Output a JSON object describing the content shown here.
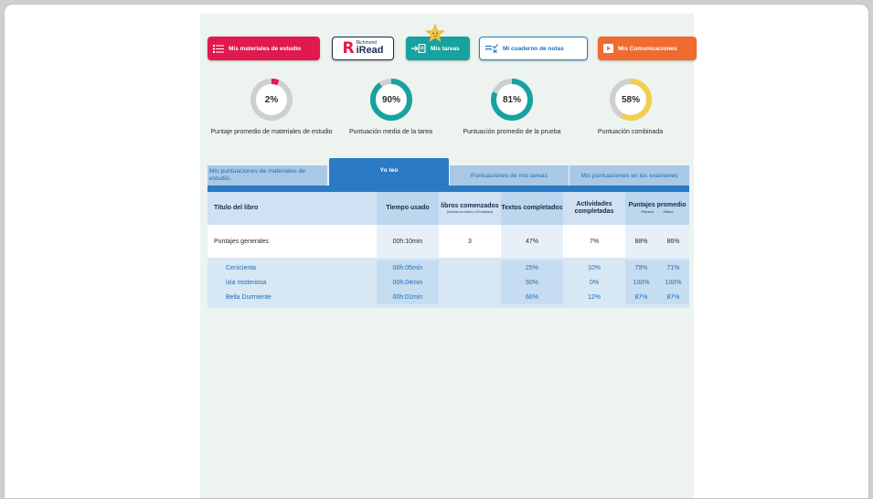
{
  "nav": {
    "materials_label": "Mis materiales de estudio",
    "iread_brand_small": "Richmond",
    "iread_brand_big": "iRead",
    "tareas_label": "Mis tareas",
    "cuaderno_label": "Mi cuaderno de notas",
    "comunicaciones_label": "Mis Comunicaciones"
  },
  "scores": [
    {
      "value": "2%",
      "percent": 2,
      "color": "#e0194f",
      "label": "Puntaje promedio de materiales de estudio"
    },
    {
      "value": "90%",
      "percent": 90,
      "color": "#16a2a0",
      "label": "Puntuación media de la tarea"
    },
    {
      "value": "81%",
      "percent": 81,
      "color": "#16a2a0",
      "label": "Puntuación promedio de la prueba"
    },
    {
      "value": "58%",
      "percent": 58,
      "color": "#f2cf4a",
      "label": "Puntuación combinada"
    }
  ],
  "tabs": {
    "materiales": "Mis puntuaciones de materiales de estudio.",
    "yoleo": "Yo leo",
    "tareas": "Puntuaciones de mis tareas",
    "examenes": "Mis puntuaciones en los exámenes"
  },
  "table": {
    "headers": {
      "titulo": "Título del libro",
      "tiempo": "Tiempo usado",
      "libros": "libros comenzados",
      "libros_note": "(mínimo un envío o 10 minutos)",
      "textos": "Textos completados",
      "actividades": "Actividades completadas",
      "puntajes": "Puntajes promedio",
      "primero": "Primero",
      "ultimo": "Último"
    },
    "general": {
      "label": "Puntajes generales",
      "tiempo": "00h:10min",
      "libros": "3",
      "textos": "47%",
      "actividades": "7%",
      "primero": "88%",
      "ultimo": "86%"
    },
    "books": [
      {
        "title": "Cenicienta",
        "tiempo": "00h:05min",
        "textos": "25%",
        "actividades": "10%",
        "primero": "79%",
        "ultimo": "71%"
      },
      {
        "title": "isla misteriosa",
        "tiempo": "00h:04min",
        "textos": "50%",
        "actividades": "0%",
        "primero": "100%",
        "ultimo": "100%"
      },
      {
        "title": "Bella Durmiente",
        "tiempo": "00h:01min",
        "textos": "66%",
        "actividades": "12%",
        "primero": "87%",
        "ultimo": "87%"
      }
    ]
  }
}
